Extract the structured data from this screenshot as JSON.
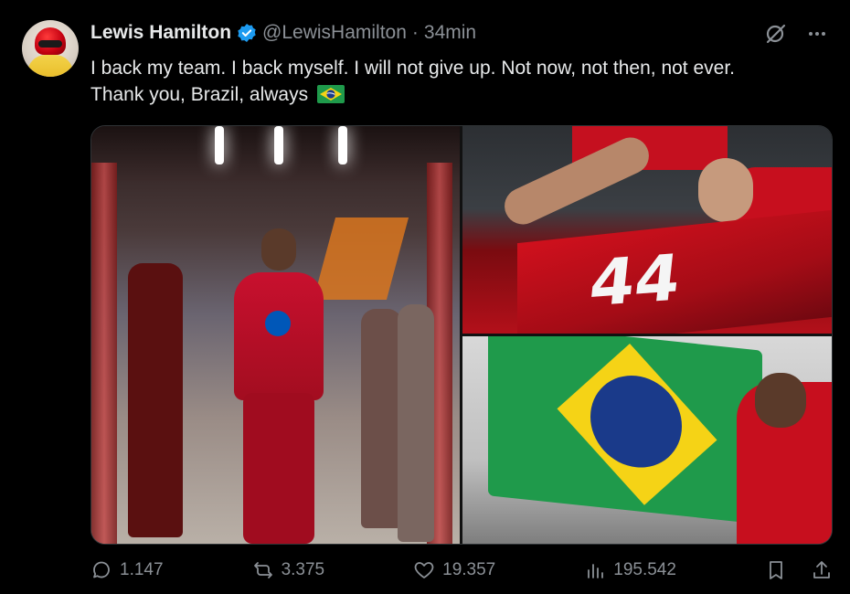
{
  "tweet": {
    "author": {
      "name": "Lewis Hamilton",
      "handle": "@LewisHamilton",
      "verified": true
    },
    "separator": "·",
    "time": "34min",
    "text_lines": [
      "I back my team. I back myself. I will not give up. Not now, not then, not ever.",
      "Thank you, Brazil, always"
    ],
    "emoji": "brazil-flag-icon",
    "media": [
      {
        "name": "photo-driver-walking",
        "overlay_text": ""
      },
      {
        "name": "photo-car-44",
        "overlay_text": "44"
      },
      {
        "name": "photo-brazil-flag",
        "overlay_text": ""
      }
    ],
    "stats": {
      "replies": "1.147",
      "reposts": "3.375",
      "likes": "19.357",
      "views": "195.542"
    }
  },
  "colors": {
    "background": "#000000",
    "text": "#e7e9ea",
    "muted": "#8b9096",
    "verified": "#1d9bf0",
    "border": "#2f3336"
  }
}
